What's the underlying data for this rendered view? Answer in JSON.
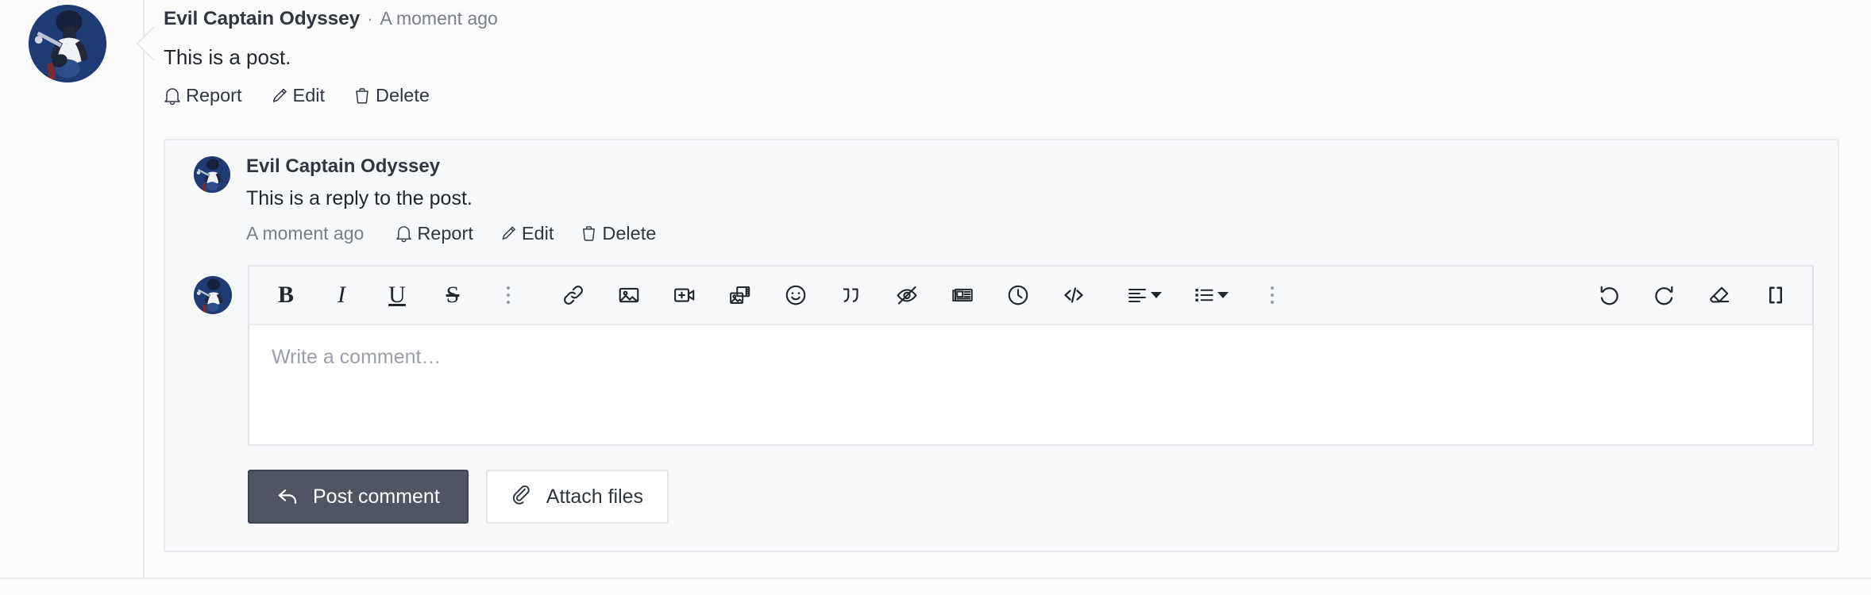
{
  "post": {
    "author": "Evil Captain Odyssey",
    "separator": "·",
    "timestamp": "A moment ago",
    "body": "This is a post.",
    "actions": [
      {
        "label": "Report",
        "icon": "bell-icon"
      },
      {
        "label": "Edit",
        "icon": "pencil-icon"
      },
      {
        "label": "Delete",
        "icon": "trash-icon"
      }
    ],
    "avatar_alt": "user-avatar"
  },
  "reply": {
    "author": "Evil Captain Odyssey",
    "body": "This is a reply to the post.",
    "timestamp": "A moment ago",
    "actions": [
      {
        "label": "Report",
        "icon": "bell-icon"
      },
      {
        "label": "Edit",
        "icon": "pencil-icon"
      },
      {
        "label": "Delete",
        "icon": "trash-icon"
      }
    ]
  },
  "editor": {
    "placeholder": "Write a comment…",
    "value": "",
    "toolbar": {
      "format_group": [
        {
          "name": "bold-button",
          "glyph": "B"
        },
        {
          "name": "italic-button",
          "glyph": "I"
        },
        {
          "name": "underline-button",
          "glyph": "U"
        },
        {
          "name": "strikethrough-button",
          "glyph": "S"
        },
        {
          "name": "more-formatting-button",
          "glyph": "⋮"
        }
      ],
      "insert_group": [
        {
          "name": "link-button",
          "icon": "link-icon"
        },
        {
          "name": "image-button",
          "icon": "image-icon"
        },
        {
          "name": "video-button",
          "icon": "add-video-icon"
        },
        {
          "name": "gallery-button",
          "icon": "media-gallery-icon"
        },
        {
          "name": "emoji-button",
          "icon": "smiley-icon"
        },
        {
          "name": "quote-button",
          "icon": "quote-icon"
        },
        {
          "name": "spoiler-button",
          "icon": "eye-off-icon"
        },
        {
          "name": "article-button",
          "icon": "news-icon"
        },
        {
          "name": "timestamp-button",
          "icon": "clock-icon"
        },
        {
          "name": "code-button",
          "icon": "code-icon"
        }
      ],
      "block_group": [
        {
          "name": "align-dropdown",
          "icon": "align-left-icon"
        },
        {
          "name": "list-dropdown",
          "icon": "bulleted-list-icon"
        },
        {
          "name": "more-options-button",
          "icon": "vertical-dots-icon"
        }
      ],
      "history_group": [
        {
          "name": "undo-button",
          "icon": "undo-icon"
        },
        {
          "name": "redo-button",
          "icon": "redo-icon"
        },
        {
          "name": "clear-formatting-button",
          "icon": "eraser-icon"
        },
        {
          "name": "source-button",
          "icon": "brackets-icon"
        }
      ]
    },
    "buttons": {
      "post": {
        "label": "Post comment",
        "icon": "reply-arrow-icon"
      },
      "attach": {
        "label": "Attach files",
        "icon": "paperclip-icon"
      }
    }
  },
  "colors": {
    "page_background": "#fbfbfc",
    "card_background": "#f7f8f9",
    "border": "#e8e9ec",
    "text": "#2f3640",
    "muted_text": "#787e88",
    "primary_button": "#4f5662",
    "avatar_background": "#1f3b73"
  }
}
